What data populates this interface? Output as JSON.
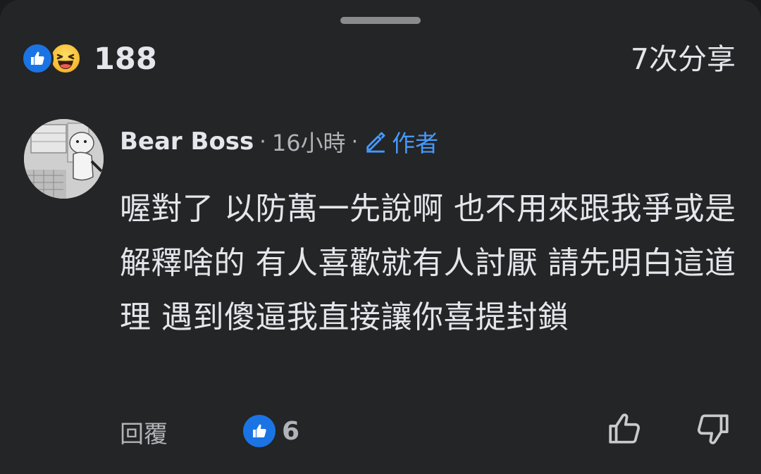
{
  "reactions": {
    "count": "188",
    "icons": [
      "like-icon",
      "haha-icon"
    ],
    "like_color": "#1b74e4"
  },
  "shares": {
    "label": "7次分享"
  },
  "comment": {
    "author": "Bear Boss",
    "separator": "·",
    "timestamp": "16小時",
    "author_badge": "作者",
    "badge_color": "#4599ff",
    "text": "喔對了 以防萬一先說啊 也不用來跟我爭或是解釋啥的 有人喜歡就有人討厭 請先明白這道理 遇到傻逼我直接讓你喜提封鎖"
  },
  "actions": {
    "reply_label": "回覆",
    "like_count": "6",
    "thumbs_up_icon": "thumbs-up-outline-icon",
    "thumbs_down_icon": "thumbs-down-outline-icon"
  }
}
